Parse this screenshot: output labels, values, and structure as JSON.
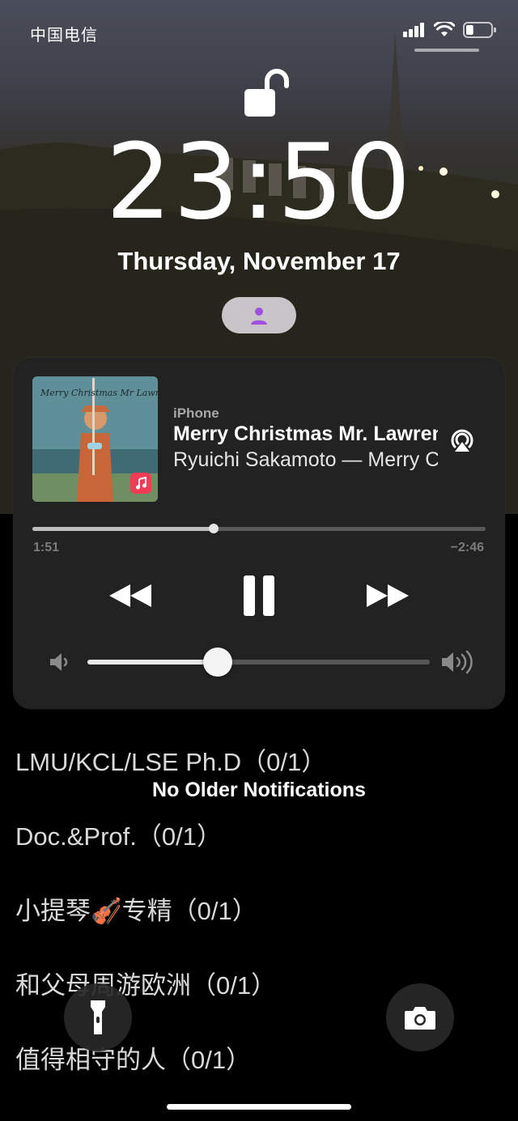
{
  "status_bar": {
    "carrier": "中国电信",
    "icons": [
      "signal-icon",
      "wifi-icon",
      "battery-icon"
    ],
    "battery_level": 0.3
  },
  "lock_screen": {
    "lock_icon": "unlocked-padlock-icon",
    "time": "23:50",
    "date": "Thursday, November 17",
    "focus_icon": "person-focus-icon"
  },
  "now_playing": {
    "device": "iPhone",
    "title": "Merry Christmas Mr. Lawrence",
    "artist_line": "Ryuichi Sakamoto — Merry Christmas Mr. Lawrence",
    "artwork_title": "Merry Christmas Mr Lawrence",
    "elapsed": "1:51",
    "remaining": "−2:46",
    "progress": 0.4,
    "volume": 0.38,
    "controls": [
      "rewind-icon",
      "pause-icon",
      "fast-forward-icon",
      "airplay-icon"
    ]
  },
  "notifications": {
    "no_older": "No Older Notifications",
    "items": [
      "LMU/KCL/LSE  Ph.D（0/1）",
      "Doc.&Prof.（0/1）",
      "小提琴🎻专精（0/1）",
      "和父母周游欧洲（0/1）",
      "值得相守的人（0/1）"
    ]
  },
  "quick_actions": [
    "flashlight-icon",
    "camera-icon"
  ],
  "colors": {
    "player_bg": "#222222",
    "apple_music": "#f23b55",
    "focus_icon": "#a050e0"
  }
}
